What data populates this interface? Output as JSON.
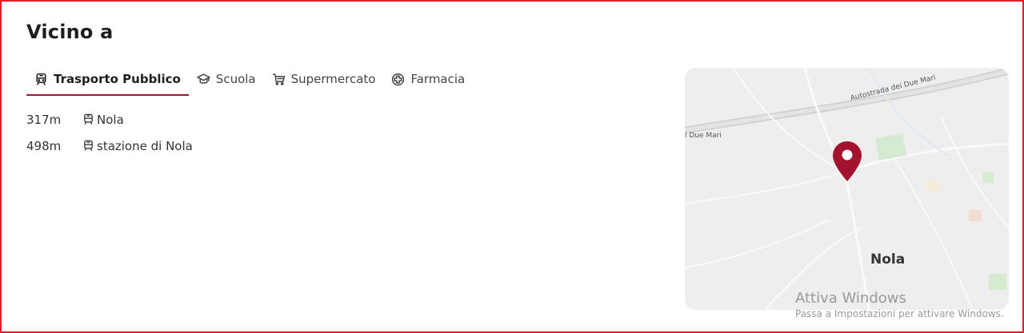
{
  "section": {
    "title": "Vicino a"
  },
  "tabs": [
    {
      "label": "Trasporto Pubblico",
      "icon": "train-icon",
      "active": true
    },
    {
      "label": "Scuola",
      "icon": "graduation-cap-icon",
      "active": false
    },
    {
      "label": "Supermercato",
      "icon": "shopping-cart-icon",
      "active": false
    },
    {
      "label": "Farmacia",
      "icon": "pharmacy-cross-icon",
      "active": false
    }
  ],
  "places": [
    {
      "distance": "317m",
      "name": "Nola",
      "icon": "train-icon"
    },
    {
      "distance": "498m",
      "name": "stazione di Nola",
      "icon": "train-icon"
    }
  ],
  "map": {
    "road_label_main": "Autostrada dei Due Mari",
    "road_label_left": "i Due Mari",
    "city_label": "Nola",
    "pin_color": "#a3122f"
  },
  "watermark": {
    "line1": "Attiva Windows",
    "line2": "Passa a Impostazioni per attivare Windows."
  },
  "colors": {
    "accent": "#a3122f",
    "frame": "#e0202a"
  }
}
